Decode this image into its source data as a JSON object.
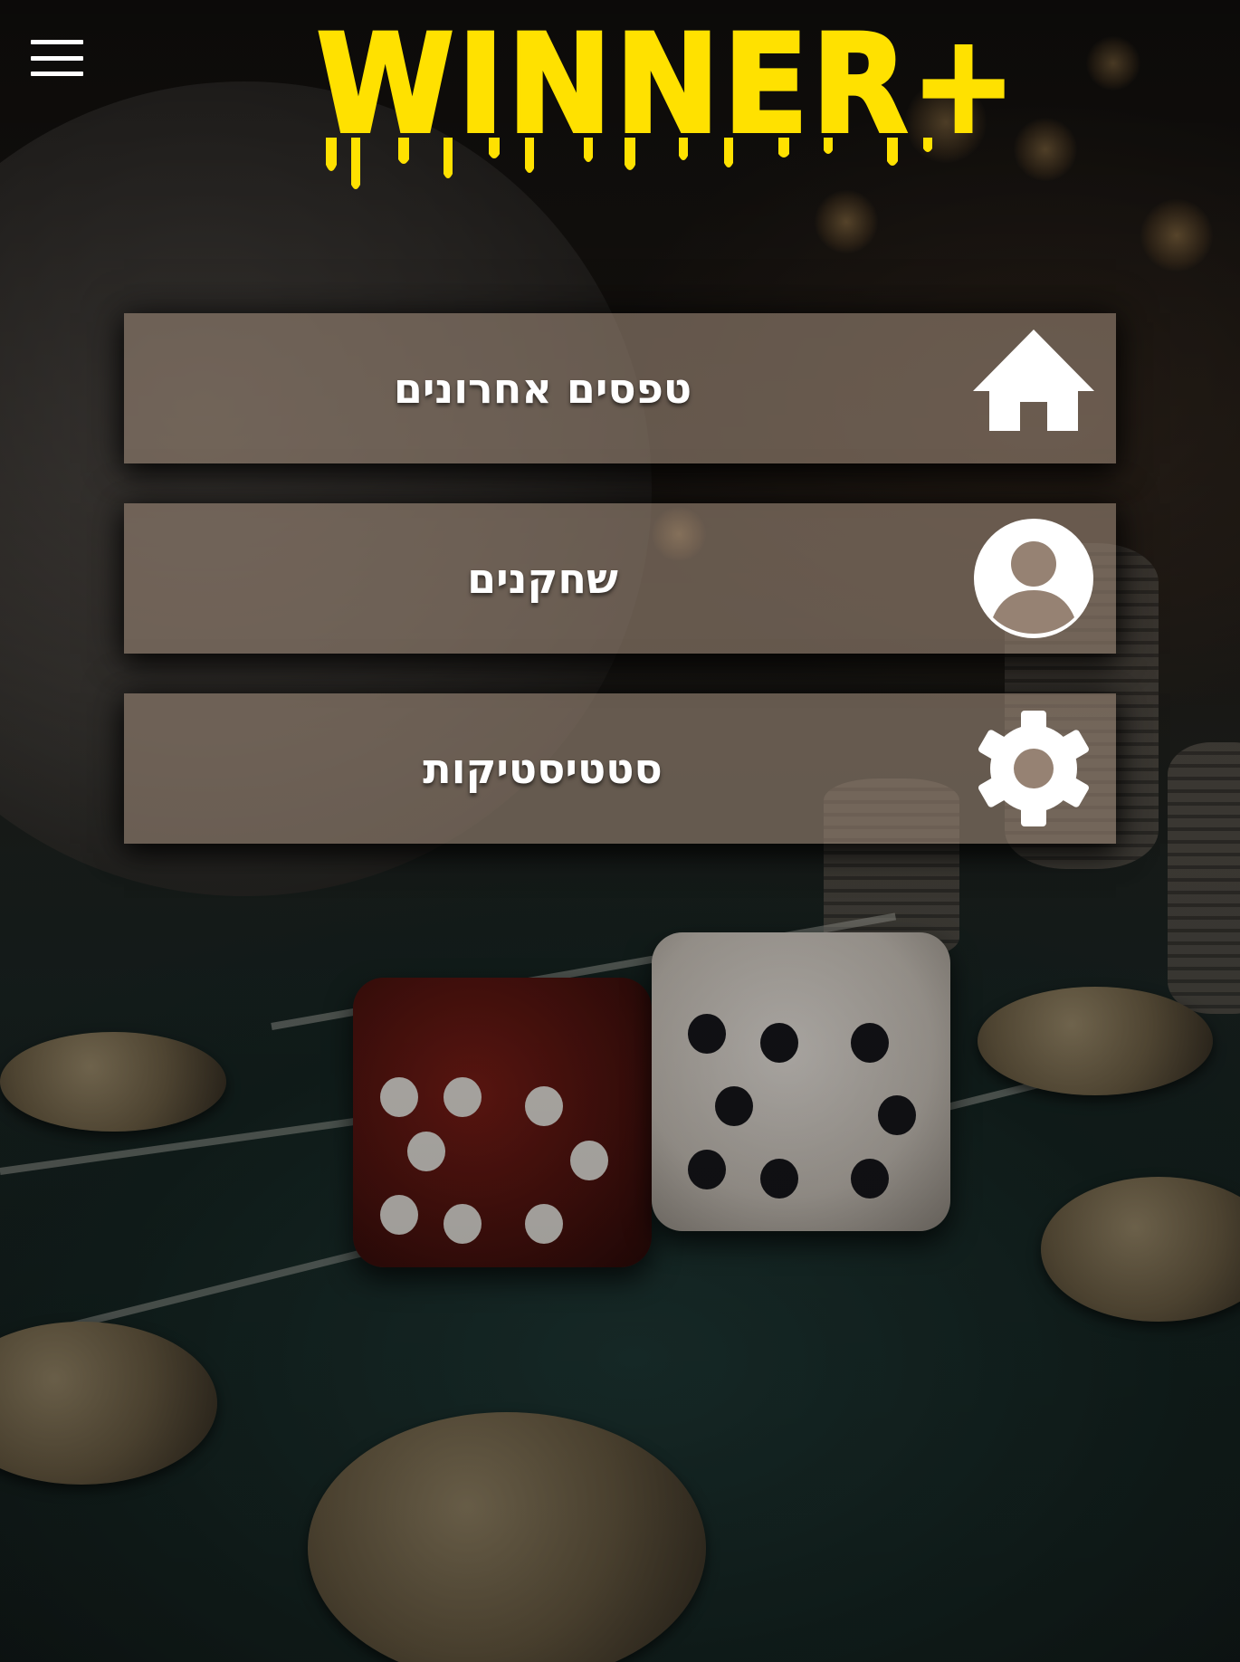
{
  "header": {
    "menu_icon": "hamburger-menu-icon",
    "logo_text": "WINNER+",
    "logo_color": "#ffe100"
  },
  "menu": {
    "items": [
      {
        "label": "טפסים אחרונים",
        "icon": "home-icon"
      },
      {
        "label": "שחקנים",
        "icon": "user-icon"
      },
      {
        "label": "סטטיסטיקות",
        "icon": "gear-icon"
      }
    ]
  },
  "colors": {
    "card_background": "#968273",
    "text": "#ffffff"
  }
}
